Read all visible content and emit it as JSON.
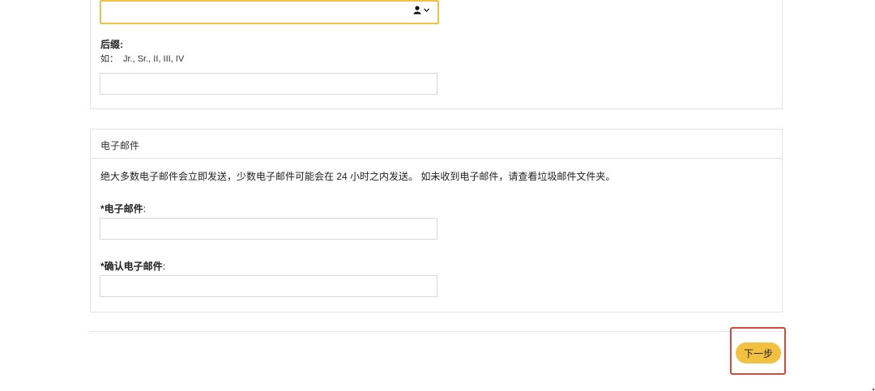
{
  "name_section": {
    "select_value": "",
    "suffix": {
      "label": "后缀:",
      "hint_prefix": "如：",
      "hint_examples": "Jr., Sr., II, III, IV",
      "value": ""
    }
  },
  "email_section": {
    "header": "电子邮件",
    "note": "绝大多数电子邮件会立即发送，少数电子邮件可能会在 24 小时之内发送。 如未收到电子邮件，请查看垃圾邮件文件夹。",
    "email_field": {
      "required_mark": "*",
      "label": "电子邮件",
      "colon": ":",
      "value": ""
    },
    "confirm_field": {
      "required_mark": "*",
      "label": "确认电子邮件",
      "colon": ":",
      "value": ""
    }
  },
  "footer": {
    "next_label": "下一步"
  },
  "colors": {
    "accent": "#f2c13f",
    "focus_border": "#f0c24a",
    "highlight": "#d9483b",
    "border": "#e3e3e3"
  },
  "icons": {
    "select_icon": "person-icon",
    "select_caret": "chevron-down-icon"
  }
}
